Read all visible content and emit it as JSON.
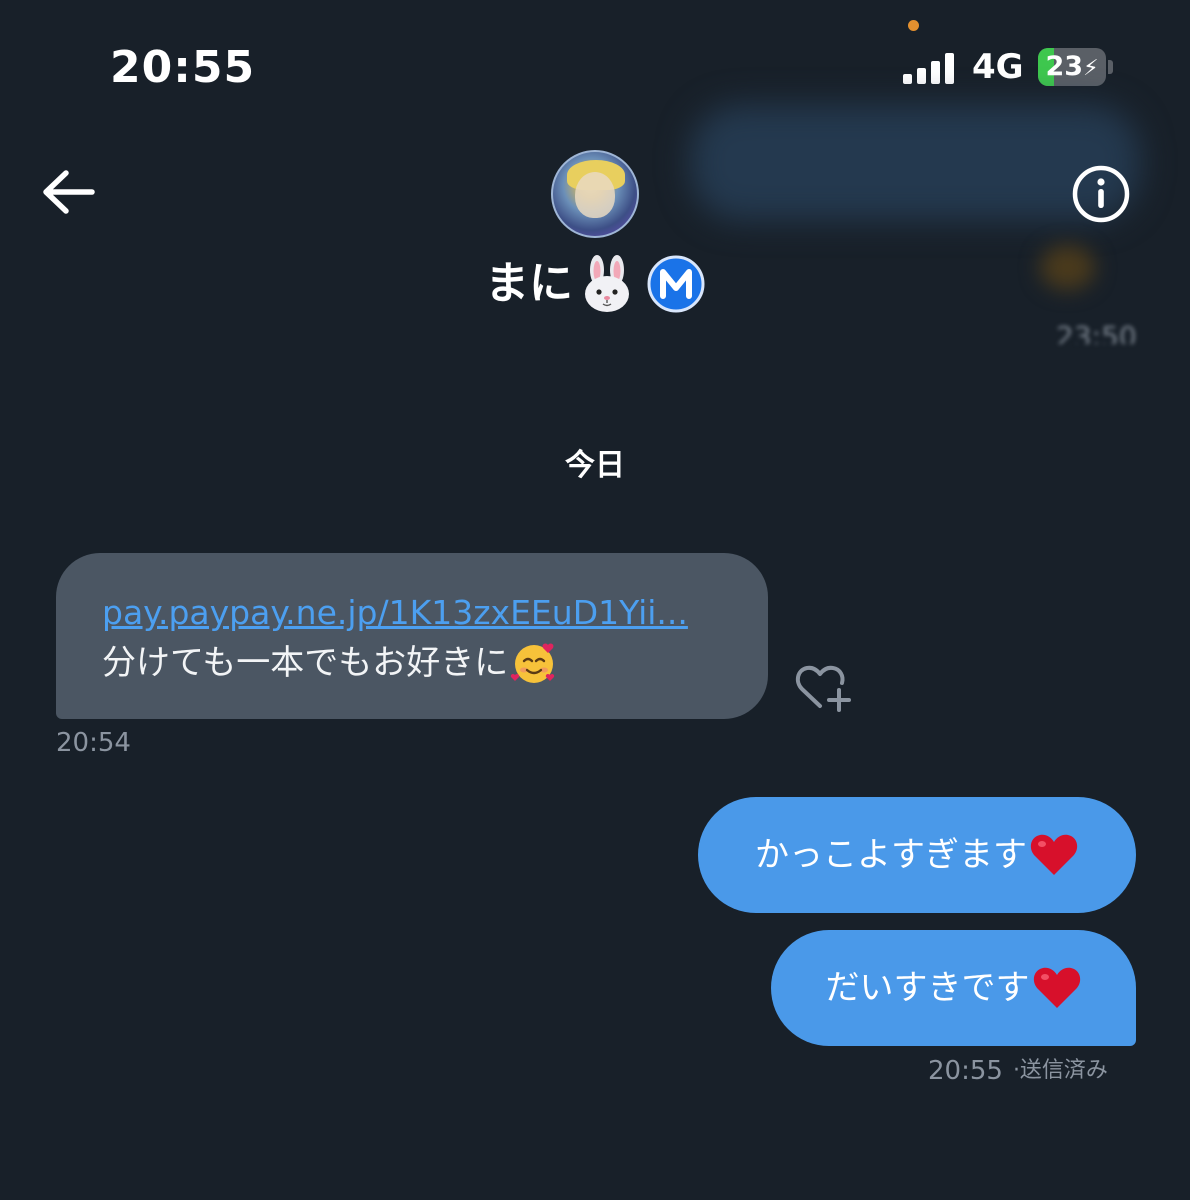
{
  "status_bar": {
    "time": "20:55",
    "network": "4G",
    "battery_level": "23",
    "battery_fraction": 0.23,
    "charging": true
  },
  "background_notification": {
    "time": "23:50"
  },
  "header": {
    "contact_name": "まに",
    "name_emoji_icon": "rabbit-face-icon",
    "badge_icon": "circled-m-icon",
    "back_icon": "arrow-left-icon",
    "info_icon": "info-circle-icon"
  },
  "conversation": {
    "date_divider": "今日",
    "incoming": {
      "link": "pay.paypay.ne.jp/1K13zxEEuD1Yii...",
      "text": "分けても一本でもお好きに",
      "emoji_icon": "smiling-face-with-hearts-icon",
      "time": "20:54",
      "reaction_icon": "heart-plus-icon"
    },
    "outgoing": [
      {
        "text": "かっこよすぎます",
        "emoji_icon": "red-heart-icon"
      },
      {
        "text": "だいすきです",
        "emoji_icon": "red-heart-icon"
      }
    ],
    "outgoing_time": "20:55",
    "outgoing_status": "·送信済み"
  },
  "colors": {
    "background": "#182029",
    "incoming_bubble": "#4b5663",
    "outgoing_bubble": "#4a99e9",
    "link": "#4c9ff0",
    "battery_fill": "#3ec74e",
    "verified_badge": "#1a73e8"
  }
}
